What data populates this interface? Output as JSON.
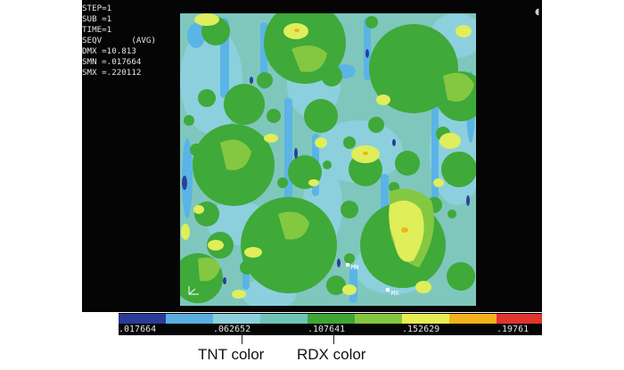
{
  "viewport": {
    "info_lines": [
      "STEP=1",
      "SUB =1",
      "TIME=1",
      "SEQV      (AVG)",
      "DMX =10.813",
      "SMN =.017664",
      "SMX =.220112"
    ],
    "marker_labels": {
      "min": "MN",
      "max": "MX"
    }
  },
  "legend": {
    "colors": [
      "#2a3b97",
      "#5aaee2",
      "#8ad0dc",
      "#6fc4b8",
      "#3fa637",
      "#86c63e",
      "#e6ee52",
      "#f2b21b",
      "#e0342f"
    ],
    "values": [
      ".017664",
      ".062652",
      ".107641",
      ".152629",
      ".19761"
    ]
  },
  "callouts": {
    "tnt": "TNT color",
    "rdx": "RDX color"
  },
  "palette": {
    "background": "#7fc7bd",
    "tnt": "#8cd0dd",
    "rdx": "#3fa93a",
    "low": "#5bb4e6",
    "high": "#dfee5a",
    "min_blue": "#2b3f9c"
  }
}
